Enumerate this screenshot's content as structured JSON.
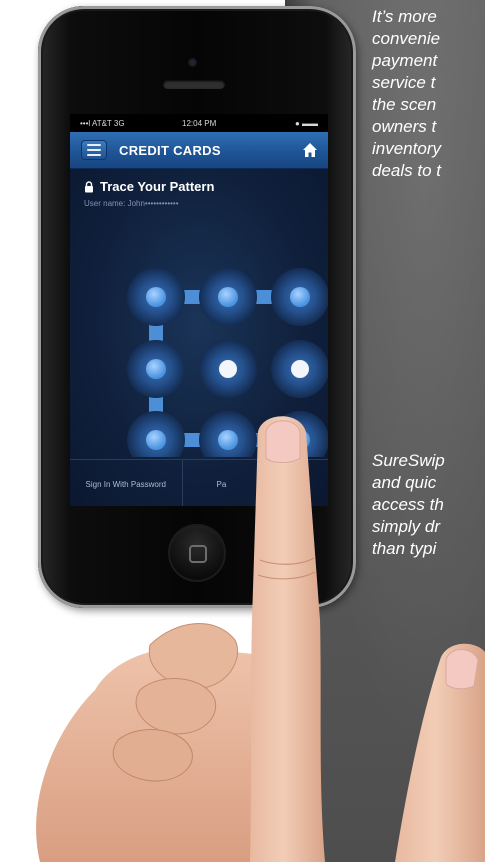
{
  "captions": {
    "top": [
      "It’s more",
      "convenie",
      "payment",
      "service t",
      "the scen",
      "owners t",
      "inventory",
      "deals to t"
    ],
    "bottom": [
      "SureSwip",
      "and quic",
      "access th",
      "simply dr",
      "than typi"
    ]
  },
  "status_bar": {
    "carrier": "•••l AT&T  3G",
    "time": "12:04 PM",
    "right": "● ▬▬"
  },
  "app_bar": {
    "title": "CREDIT CARDS"
  },
  "login": {
    "heading": "Trace Your Pattern",
    "username": "User name: John••••••••••••"
  },
  "pattern": {
    "grid": "3x3",
    "selected_dots": [
      1,
      2,
      3,
      4,
      7,
      8,
      9
    ]
  },
  "tabs": [
    {
      "label": "Sign In With Password"
    },
    {
      "label": "Pa"
    }
  ],
  "colors": {
    "panel": "#5a5a5a",
    "appbar": "#1f5596",
    "screen_bg": "#10213d",
    "dot_active": "#5da3e8",
    "connector": "#4d8fd6",
    "caption_text": "#ffffff"
  }
}
